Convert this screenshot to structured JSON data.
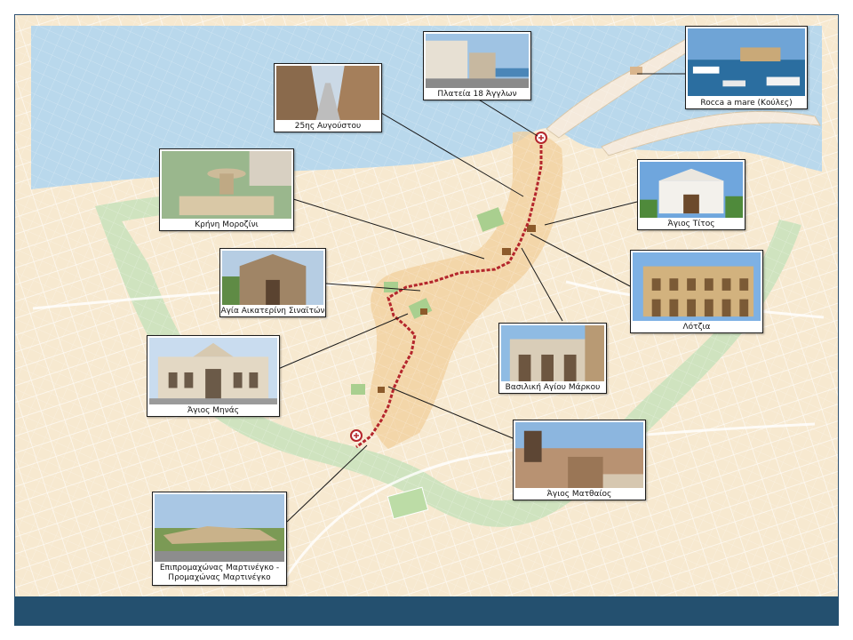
{
  "colors": {
    "sea": "#b9d8ec",
    "land": "#f7e9d0",
    "walls_park": "#cfe3bf",
    "old_town": "#f2cf9c",
    "route": "#b4262c",
    "footer_bar": "#24506f",
    "callout_line": "#1a1a1a"
  },
  "map": {
    "route_start_marker": "route-pin-icon",
    "route_end_marker": "route-pin-icon"
  },
  "callouts": {
    "rocca": {
      "label": "Rocca a mare (Κούλες)",
      "photo": "harbour-fortress-photo"
    },
    "plateia": {
      "label": "Πλατεία 18 Άγγλων",
      "photo": "square-buildings-photo"
    },
    "augoustou": {
      "label": "25ης Αυγούστου",
      "photo": "street-photo"
    },
    "morozini": {
      "label": "Κρήνη Μοροζίνι",
      "photo": "fountain-photo"
    },
    "titos": {
      "label": "Άγιος Τίτος",
      "photo": "white-church-photo"
    },
    "lotzia": {
      "label": "Λότζια",
      "photo": "loggia-photo"
    },
    "aikaterini": {
      "label": "Αγία Αικατερίνη Σιναϊτών",
      "photo": "stone-church-photo"
    },
    "markos": {
      "label": "Βασιλική Αγίου Μάρκου",
      "photo": "basilica-photo"
    },
    "minas": {
      "label": "Άγιος Μηνάς",
      "photo": "cathedral-photo"
    },
    "matthaios": {
      "label": "Άγιος Ματθαίος",
      "photo": "chapel-photo"
    },
    "martinengo": {
      "line1": "Επιπρομαχώνας Μαρτινέγκο -",
      "line2": "Προμαχώνας Μαρτινέγκο",
      "photo": "bastion-photo"
    }
  }
}
